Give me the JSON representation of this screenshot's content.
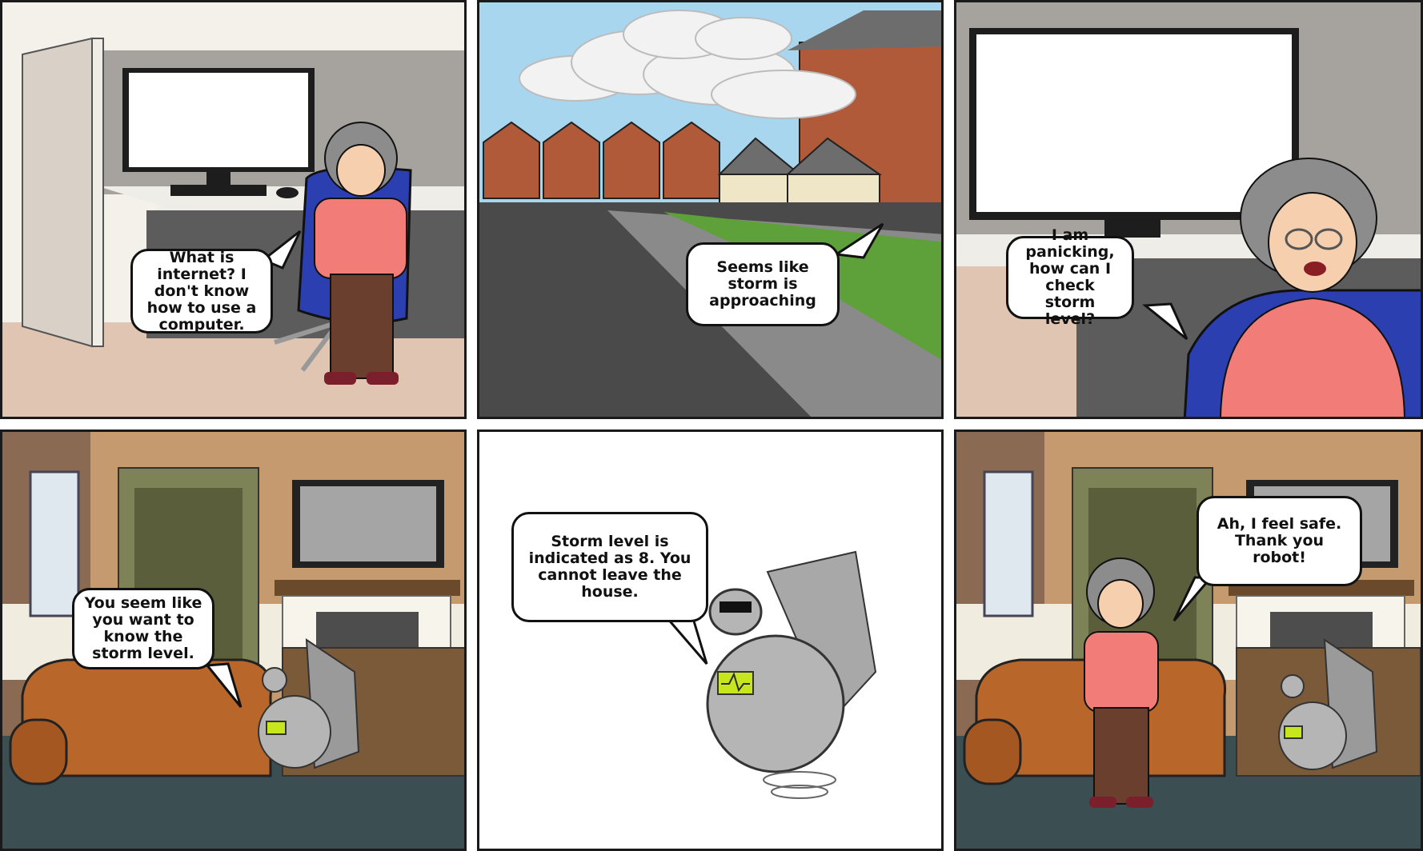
{
  "panels": [
    {
      "id": 1,
      "speech": "What is internet? I don't know how to use a computer."
    },
    {
      "id": 2,
      "speech": "Seems like storm is approaching"
    },
    {
      "id": 3,
      "speech": "I am panicking, how can I check storm level?"
    },
    {
      "id": 4,
      "speech": "You seem like you want to know the storm level."
    },
    {
      "id": 5,
      "speech": "Storm level is indicated as 8. You cannot leave the house."
    },
    {
      "id": 6,
      "speech": "Ah, I feel safe. Thank you robot!"
    }
  ],
  "colors": {
    "grandma_shirt": "#f27c78",
    "grandma_pants": "#6b3f2e",
    "grandma_hair": "#8c8c8c",
    "chair_blue": "#2b3fb0",
    "sofa": "#b8662a",
    "robot_metal": "#b5b5b5",
    "robot_screen": "#c8e61e",
    "sky": "#a8d6ee",
    "grass": "#5ea03a",
    "brick": "#b05a3a"
  },
  "icons": {
    "robot": "robot-turkey-icon",
    "computer": "computer-monitor-icon",
    "storm": "storm-cloud-icon"
  }
}
